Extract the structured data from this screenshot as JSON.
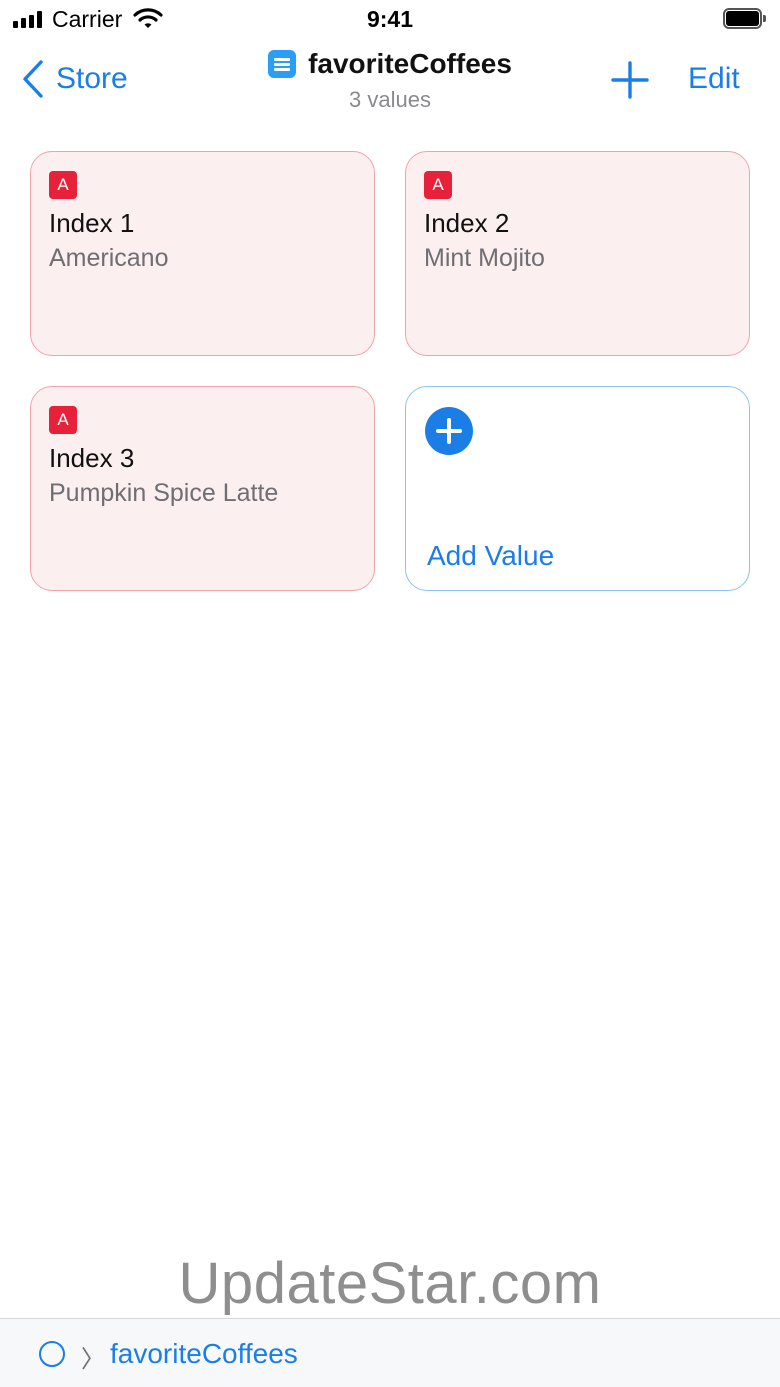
{
  "status_bar": {
    "carrier": "Carrier",
    "time": "9:41",
    "icons": [
      "signal-icon",
      "wifi-icon",
      "battery-icon"
    ]
  },
  "nav": {
    "back_label": "Store",
    "title": "favoriteCoffees",
    "subtitle": "3 values",
    "edit_label": "Edit",
    "icons": [
      "chevron-left-icon",
      "list-icon",
      "plus-icon"
    ]
  },
  "values": [
    {
      "badge": "A",
      "label": "Index 1",
      "value": "Americano"
    },
    {
      "badge": "A",
      "label": "Index 2",
      "value": "Mint Mojito"
    },
    {
      "badge": "A",
      "label": "Index 3",
      "value": "Pumpkin Spice Latte"
    }
  ],
  "add_card": {
    "label": "Add Value",
    "icon": "plus-circle-icon"
  },
  "watermark": "UpdateStar.com",
  "breadcrumb": {
    "root_icon": "circle-icon",
    "separator": "〉",
    "items": [
      "favoriteCoffees"
    ]
  },
  "colors": {
    "accent": "#1a7ee6",
    "badge": "#e8213b",
    "card_fill": "#fcefef",
    "card_border": "#f0a3a8",
    "add_border": "#8fc2ee"
  }
}
